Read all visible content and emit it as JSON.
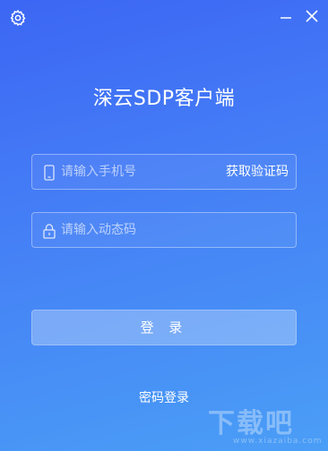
{
  "window": {
    "gradient_start": "#3c66f4",
    "gradient_end": "#4a9ef6",
    "controls": [
      "settings-icon",
      "minimize-icon",
      "close-icon"
    ]
  },
  "title": "深云SDP客户端",
  "phone_field": {
    "placeholder": "请输入手机号",
    "icon": "phone-icon",
    "action_label": "获取验证码"
  },
  "code_field": {
    "placeholder": "请输入动态码",
    "icon": "lock-icon"
  },
  "login_button": {
    "label": "登 录"
  },
  "password_login_link": {
    "label": "密码登录"
  },
  "watermark": {
    "text": "下载吧",
    "sub": "www.xiazaiba.com"
  }
}
